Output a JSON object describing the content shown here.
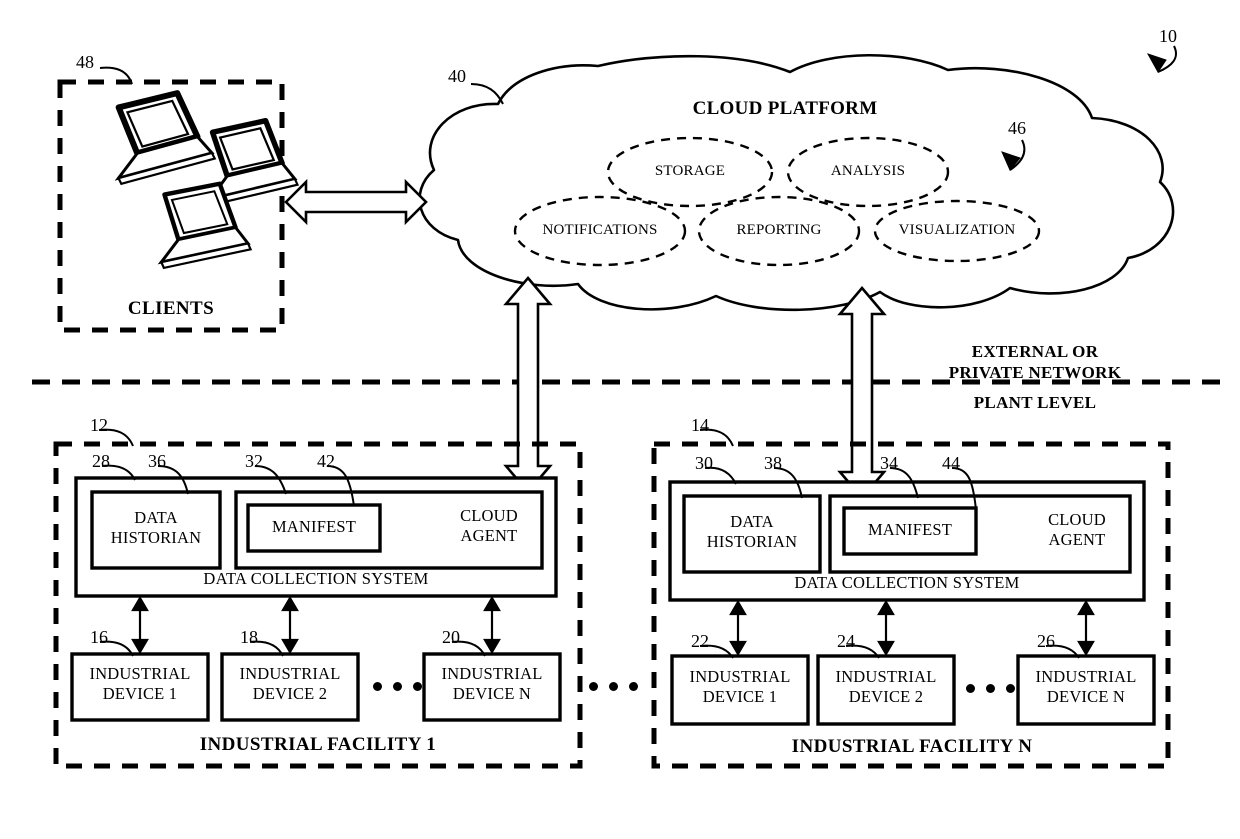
{
  "figure": {
    "ref_main": "10",
    "cloud": {
      "ref": "40",
      "title": "CLOUD PLATFORM",
      "services_ref": "46",
      "services": [
        {
          "label": "STORAGE"
        },
        {
          "label": "ANALYSIS"
        },
        {
          "label": "NOTIFICATIONS"
        },
        {
          "label": "REPORTING"
        },
        {
          "label": "VISUALIZATION"
        }
      ]
    },
    "clients": {
      "ref": "48",
      "label": "CLIENTS",
      "icon": "laptop-icon"
    },
    "network_divider": {
      "upper_line1": "EXTERNAL OR",
      "upper_line2": "PRIVATE NETWORK",
      "lower": "PLANT LEVEL"
    },
    "facilities": [
      {
        "ref": "12",
        "title": "INDUSTRIAL FACILITY 1",
        "collection_system_label": "DATA COLLECTION SYSTEM",
        "historian": {
          "ref": "28",
          "ref2": "36",
          "line1": "DATA",
          "line2": "HISTORIAN"
        },
        "cloud_agent": {
          "ref": "32",
          "line1": "CLOUD",
          "line2": "AGENT"
        },
        "manifest": {
          "ref": "42",
          "label": "MANIFEST"
        },
        "devices": [
          {
            "ref": "16",
            "line1": "INDUSTRIAL",
            "line2": "DEVICE 1"
          },
          {
            "ref": "18",
            "line1": "INDUSTRIAL",
            "line2": "DEVICE 2"
          },
          {
            "ref": "20",
            "line1": "INDUSTRIAL",
            "line2": "DEVICE N"
          }
        ]
      },
      {
        "ref": "14",
        "title": "INDUSTRIAL FACILITY N",
        "collection_system_label": "DATA COLLECTION SYSTEM",
        "historian": {
          "ref": "30",
          "ref2": "38",
          "line1": "DATA",
          "line2": "HISTORIAN"
        },
        "cloud_agent": {
          "ref": "34",
          "line1": "CLOUD",
          "line2": "AGENT"
        },
        "manifest": {
          "ref": "44",
          "label": "MANIFEST"
        },
        "devices": [
          {
            "ref": "22",
            "line1": "INDUSTRIAL",
            "line2": "DEVICE 1"
          },
          {
            "ref": "24",
            "line1": "INDUSTRIAL",
            "line2": "DEVICE 2"
          },
          {
            "ref": "26",
            "line1": "INDUSTRIAL",
            "line2": "DEVICE N"
          }
        ]
      }
    ],
    "colors": {
      "ink": "#000000",
      "paper": "#ffffff"
    }
  }
}
